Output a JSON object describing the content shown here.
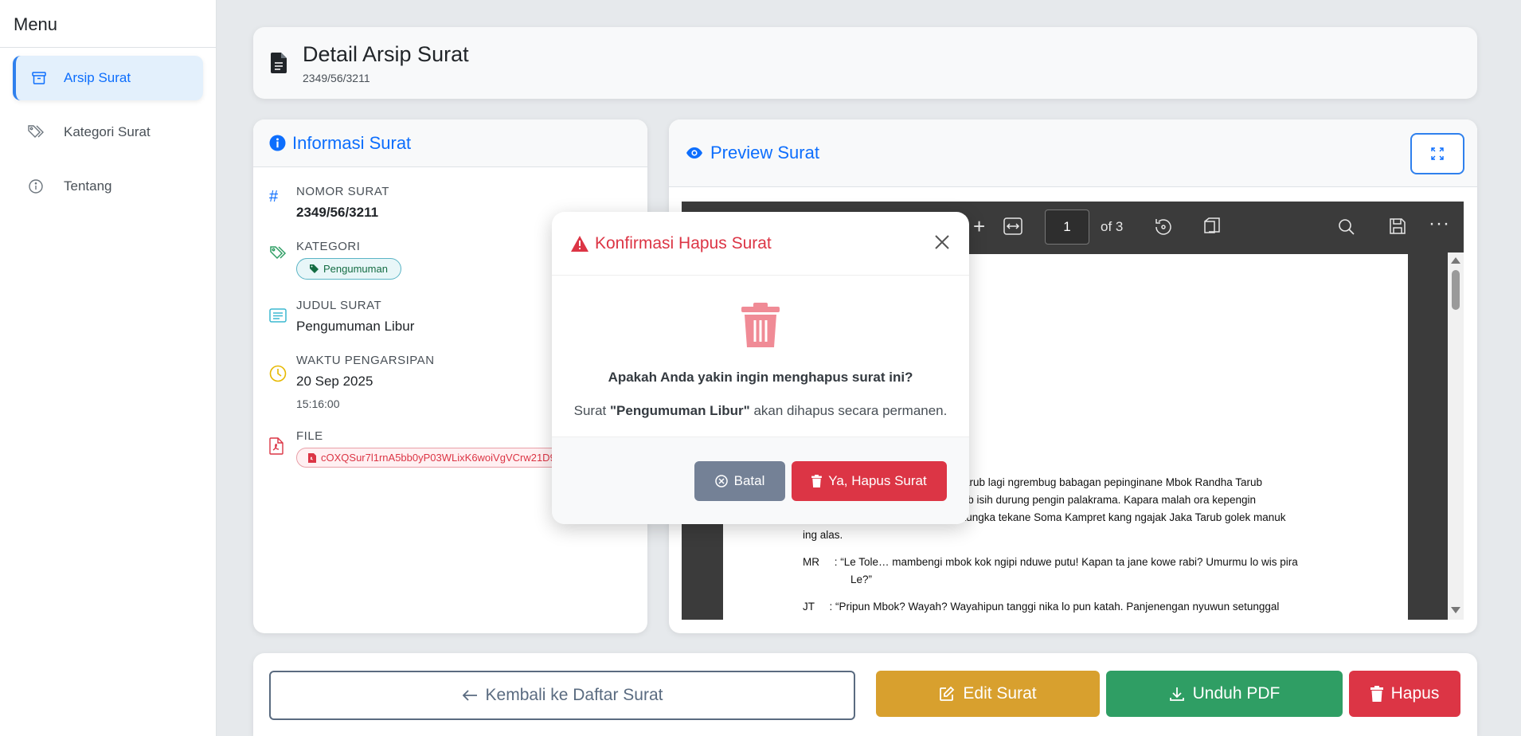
{
  "sidebar": {
    "title": "Menu",
    "items": [
      {
        "label": "Arsip Surat"
      },
      {
        "label": "Kategori Surat"
      },
      {
        "label": "Tentang"
      }
    ]
  },
  "header": {
    "title": "Detail Arsip Surat",
    "subtitle": "2349/56/3211"
  },
  "info": {
    "heading": "Informasi Surat",
    "nomor_label": "NOMOR SURAT",
    "nomor_value": "2349/56/3211",
    "kategori_label": "KATEGORI",
    "kategori_value": "Pengumuman",
    "judul_label": "JUDUL SURAT",
    "judul_value": "Pengumuman Libur",
    "waktu_label": "WAKTU PENGARSIPAN",
    "waktu_date": "20 Sep 2025",
    "waktu_time": "15:16:00",
    "file_label": "FILE",
    "file_value": "cOXQSur7l1rnA5bb0yP03WLixK6woiVgVCrw21D9.pdf"
  },
  "preview": {
    "heading": "Preview Surat",
    "page_number": "1",
    "page_total": "of 3",
    "lines": [
      "aka Tarub lagi ngrembug babagan pepinginane Mbok Randha Tarub",
      "a Tarub isih durung pengin palakrama. Kapara malah ora kepengin",
      "n. Katungka tekane Soma Kampret kang ngajak Jaka Tarub golek manuk",
      "ing alas.",
      "MR     : “Le Tole… mambengi mbok kok ngipi nduwe putu! Kapan ta jane kowe rabi? Umurmu lo wis pira",
      "Le?”",
      "JT     : “Pripun Mbok? Wayah? Wayahipun tanggi nika lo pun katah. Panjenengan nyuwun setunggal"
    ]
  },
  "actions": {
    "back": "Kembali ke Daftar Surat",
    "edit": "Edit Surat",
    "download": "Unduh PDF",
    "delete": "Hapus"
  },
  "modal": {
    "title": "Konfirmasi Hapus Surat",
    "question": "Apakah Anda yakin ingin menghapus surat ini?",
    "msg_prefix": "Surat ",
    "msg_name": "\"Pengumuman Libur\"",
    "msg_suffix": " akan dihapus secara permanen.",
    "cancel": "Batal",
    "confirm": "Ya, Hapus Surat"
  },
  "colors": {
    "primary": "#0d6efd",
    "danger": "#dc3545",
    "warning": "#d8a02e",
    "success": "#2f9e64",
    "secondary": "#748196"
  }
}
